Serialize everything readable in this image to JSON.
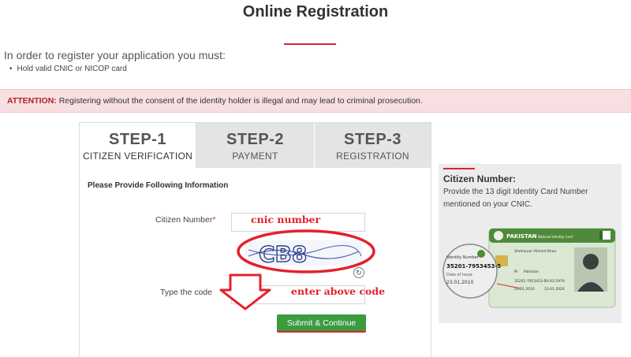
{
  "page": {
    "title": "Online Registration",
    "intro": "In order to register your application you must:",
    "requirement": "Hold valid CNIC or NICOP card",
    "attention_label": "ATTENTION:",
    "attention_text": "Registering without the consent of the identity holder is illegal and may lead to criminal prosecution."
  },
  "tabs": [
    {
      "step": "STEP-1",
      "label": "CITIZEN VERIFICATION",
      "active": true
    },
    {
      "step": "STEP-2",
      "label": "PAYMENT",
      "active": false
    },
    {
      "step": "STEP-3",
      "label": "REGISTRATION",
      "active": false
    }
  ],
  "form": {
    "heading": "Please Provide Following Information",
    "citizen_label": "Citizen Number",
    "required_mark": "*",
    "citizen_value": "",
    "captcha_text": "CB8",
    "code_label": "Type the code",
    "code_value": "",
    "submit_label": "Submit & Continue"
  },
  "annotations": {
    "cnic": "cnic number",
    "code": "enter above code",
    "color": "#e3212c"
  },
  "side_panel": {
    "title": "Citizen Number:",
    "text": "Provide the 13 digit Identity Card Number mentioned on your CNIC.",
    "card": {
      "country": "PAKISTAN",
      "subtitle": "National Identity Card",
      "name": "Sheharyar Ahmed Khan",
      "id_label": "Identity Number",
      "id_number": "35201-7953453-5",
      "date_label": "Date of Issue",
      "date_value": "23.01.2010",
      "gender": "M",
      "country_of_stay": "Pakistan",
      "dob": "19.03.1979",
      "issue": "23.01.2010",
      "expiry": "23.01.2024"
    }
  },
  "colors": {
    "accent_red": "#d9262c",
    "button_green": "#3a9b3f",
    "attention_bg": "#f8dfe1"
  },
  "icons": {
    "refresh": "refresh-icon",
    "bullet": "bullet-icon"
  }
}
